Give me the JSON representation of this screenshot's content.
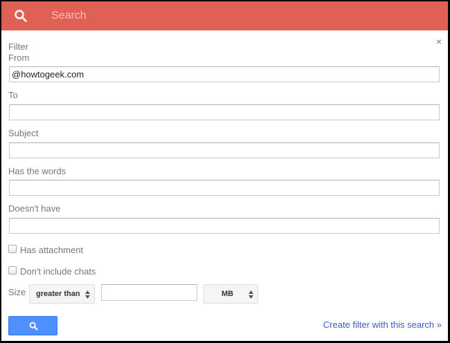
{
  "header": {
    "search_placeholder": "Search"
  },
  "dialog": {
    "title": "Filter",
    "close": "×",
    "from": {
      "label": "From",
      "value": "@howtogeek.com"
    },
    "to": {
      "label": "To",
      "value": ""
    },
    "subject": {
      "label": "Subject",
      "value": ""
    },
    "has_words": {
      "label": "Has the words",
      "value": ""
    },
    "doesnt_have": {
      "label": "Doesn't have",
      "value": ""
    },
    "has_attachment": {
      "label": "Has attachment",
      "checked": false
    },
    "no_chats": {
      "label": "Don't include chats",
      "checked": false
    },
    "size": {
      "label": "Size",
      "comparator": "greater than",
      "value": "",
      "unit": "MB"
    },
    "create_filter": "Create filter with this search »"
  },
  "colors": {
    "header": "#e06055",
    "button": "#4d90fe",
    "link": "#3b5bc6"
  }
}
